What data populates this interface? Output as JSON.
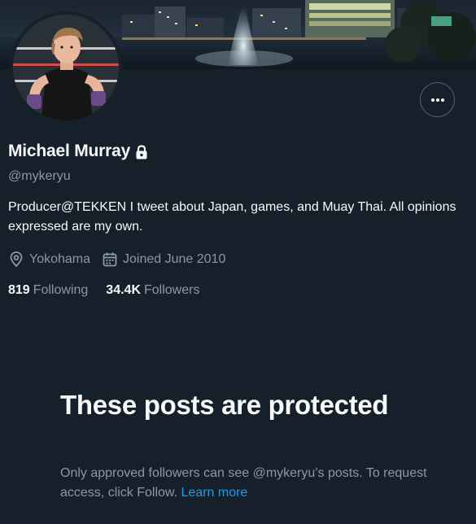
{
  "profile": {
    "display_name": "Michael Murray",
    "handle": "@mykeryu",
    "bio": "Producer@TEKKEN I tweet about Japan, games, and Muay Thai. All opinions expressed are my own.",
    "location": "Yokohama",
    "joined": "Joined June 2010",
    "following_count": "819",
    "following_label": "Following",
    "followers_count": "34.4K",
    "followers_label": "Followers"
  },
  "protected": {
    "title": "These posts are protected",
    "description": "Only approved followers can see @mykeryu’s posts. To request access, click Follow.",
    "learn_more": "Learn more"
  },
  "icons": {
    "more": "more-horizontal-icon",
    "lock": "lock-icon",
    "location": "location-pin-icon",
    "calendar": "calendar-icon"
  },
  "colors": {
    "background": "#15202b",
    "text_primary": "#f7f9f9",
    "text_secondary": "#8b98a5",
    "accent": "#1d9bf0",
    "border": "#536471"
  }
}
